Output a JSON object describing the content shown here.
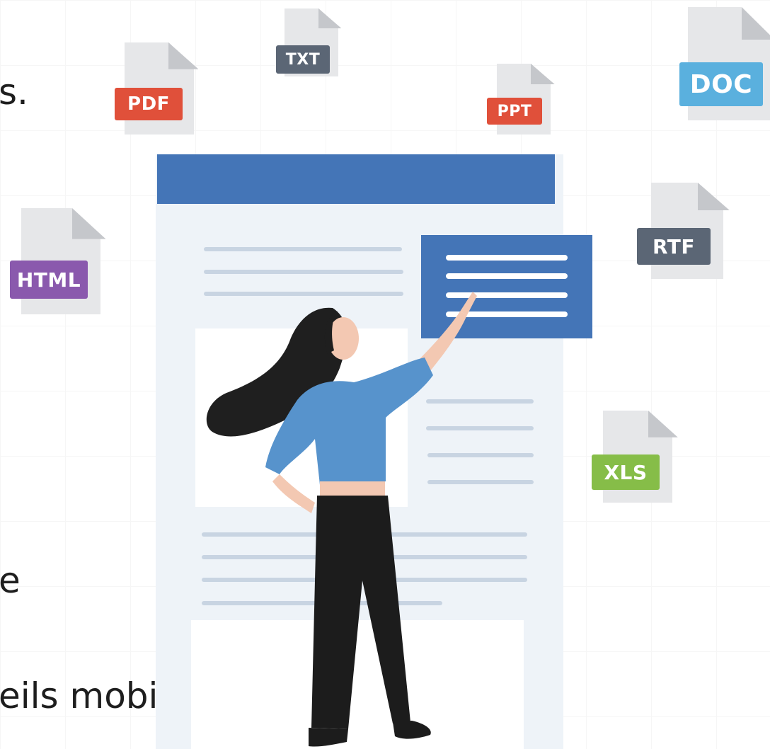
{
  "left_text": {
    "line1_fragment": "s.",
    "line2_fragment": "e",
    "line3_fragment": "eils mobiles"
  },
  "file_icons": [
    {
      "label": "TXT",
      "color": "#5b6675"
    },
    {
      "label": "PDF",
      "color": "#e0503a"
    },
    {
      "label": "PPT",
      "color": "#e0503a"
    },
    {
      "label": "DOC",
      "color": "#5ab0de"
    },
    {
      "label": "HTML",
      "color": "#8a59ad"
    },
    {
      "label": "RTF",
      "color": "#5b6675"
    },
    {
      "label": "XLS",
      "color": "#86bd48"
    }
  ],
  "colors": {
    "header_blue": "#4475b7",
    "page_bg": "#eef3f8",
    "line_gray": "#c8d4e2",
    "shirt_blue": "#5793cc",
    "hair": "#1f1f1f",
    "skin": "#f3c8b2",
    "pants": "#1c1c1c"
  }
}
